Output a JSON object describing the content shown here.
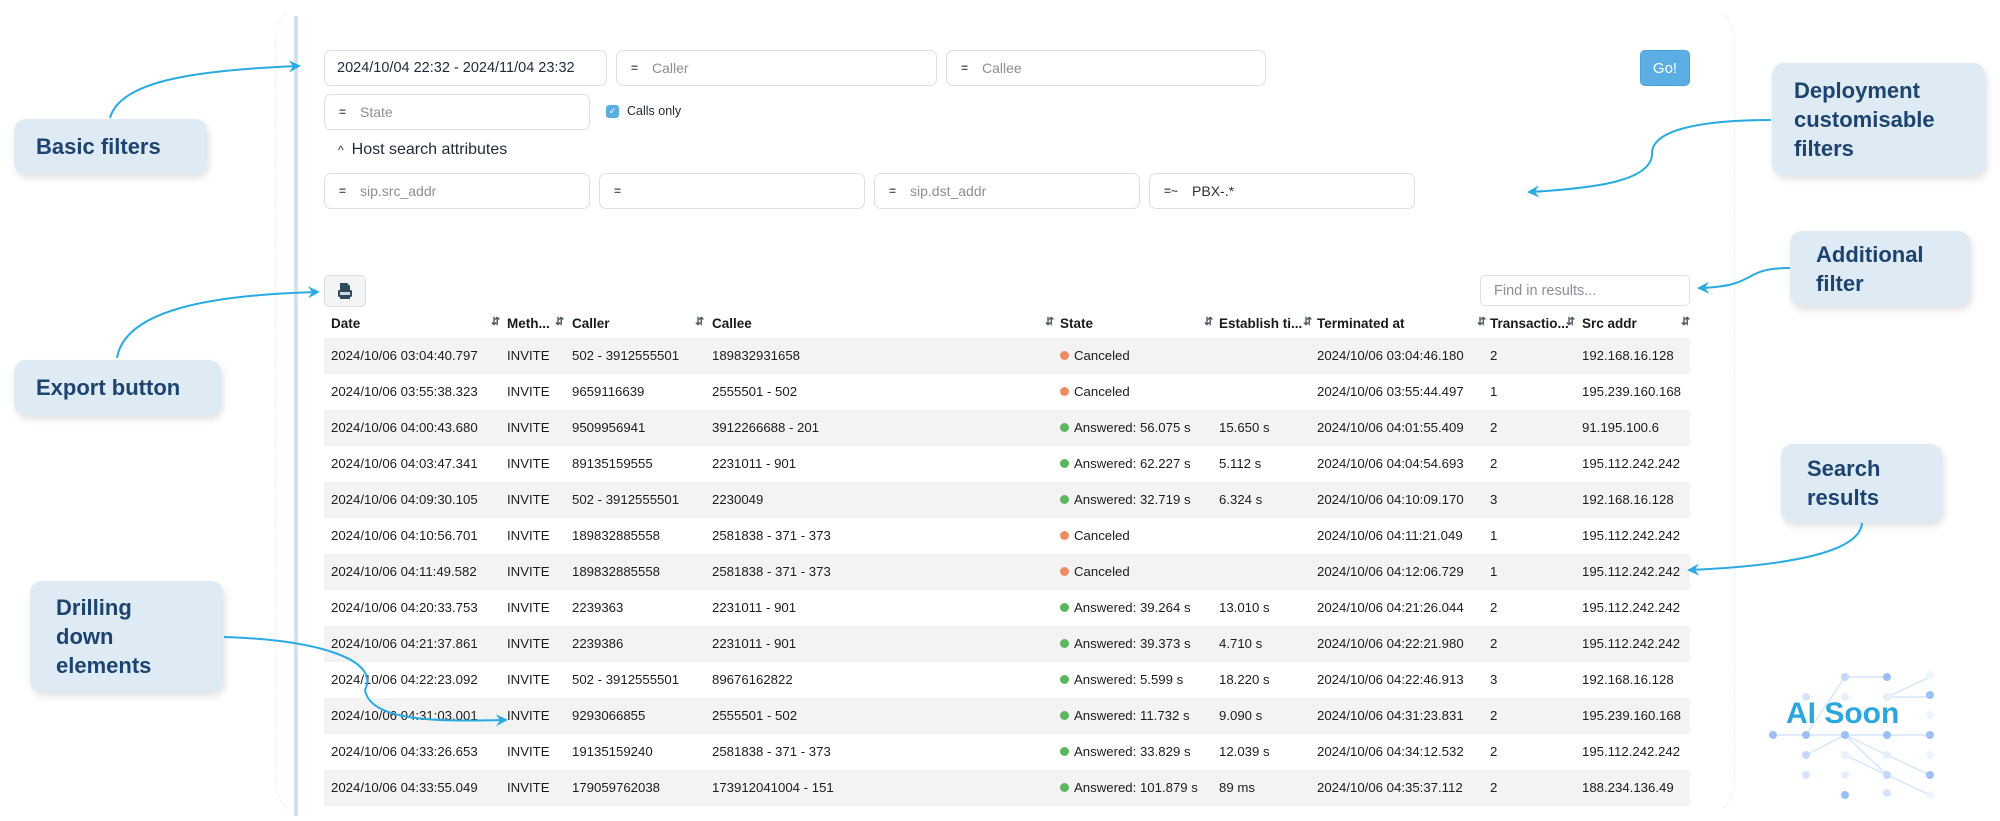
{
  "filters": {
    "date_range": "2024/10/04 22:32 - 2024/11/04 23:32",
    "caller": {
      "operator": "=",
      "placeholder": "Caller"
    },
    "callee": {
      "operator": "=",
      "placeholder": "Callee"
    },
    "state": {
      "operator": "=",
      "placeholder": "State"
    },
    "calls_only": {
      "label": "Calls only",
      "checked": true
    },
    "go_label": "Go!"
  },
  "host_search": {
    "toggle_label": "Host search attributes",
    "fields": [
      {
        "operator": "=",
        "placeholder": "sip.src_addr",
        "value": ""
      },
      {
        "operator": "=",
        "placeholder": "",
        "value": ""
      },
      {
        "operator": "=",
        "placeholder": "sip.dst_addr",
        "value": ""
      },
      {
        "operator": "=~",
        "placeholder": "",
        "value": "PBX-.*"
      }
    ]
  },
  "results": {
    "export_icon": "csv-export-icon",
    "find_placeholder": "Find in results...",
    "columns": [
      "Date",
      "Meth...",
      "Caller",
      "Callee",
      "State",
      "Establish ti...",
      "Terminated at",
      "Transactio...",
      "Src addr"
    ],
    "rows": [
      {
        "date": "2024/10/06 03:04:40.797",
        "method": "INVITE",
        "caller": "502 - 3912555501",
        "callee": "189832931658",
        "state": "Canceled",
        "state_type": "canceled",
        "establish": "",
        "terminated": "2024/10/06 03:04:46.180",
        "transactions": "2",
        "src": "192.168.16.128"
      },
      {
        "date": "2024/10/06 03:55:38.323",
        "method": "INVITE",
        "caller": "9659116639",
        "callee": "2555501 - 502",
        "state": "Canceled",
        "state_type": "canceled",
        "establish": "",
        "terminated": "2024/10/06 03:55:44.497",
        "transactions": "1",
        "src": "195.239.160.168"
      },
      {
        "date": "2024/10/06 04:00:43.680",
        "method": "INVITE",
        "caller": "9509956941",
        "callee": "3912266688 - 201",
        "state": "Answered: 56.075 s",
        "state_type": "answered",
        "establish": "15.650 s",
        "terminated": "2024/10/06 04:01:55.409",
        "transactions": "2",
        "src": "91.195.100.6"
      },
      {
        "date": "2024/10/06 04:03:47.341",
        "method": "INVITE",
        "caller": "89135159555",
        "callee": "2231011 - 901",
        "state": "Answered: 62.227 s",
        "state_type": "answered",
        "establish": "5.112 s",
        "terminated": "2024/10/06 04:04:54.693",
        "transactions": "2",
        "src": "195.112.242.242"
      },
      {
        "date": "2024/10/06 04:09:30.105",
        "method": "INVITE",
        "caller": "502 - 3912555501",
        "callee": "2230049",
        "state": "Answered: 32.719 s",
        "state_type": "answered",
        "establish": "6.324 s",
        "terminated": "2024/10/06 04:10:09.170",
        "transactions": "3",
        "src": "192.168.16.128"
      },
      {
        "date": "2024/10/06 04:10:56.701",
        "method": "INVITE",
        "caller": "189832885558",
        "callee": "2581838 - 371 - 373",
        "state": "Canceled",
        "state_type": "canceled",
        "establish": "",
        "terminated": "2024/10/06 04:11:21.049",
        "transactions": "1",
        "src": "195.112.242.242"
      },
      {
        "date": "2024/10/06 04:11:49.582",
        "method": "INVITE",
        "caller": "189832885558",
        "callee": "2581838 - 371 - 373",
        "state": "Canceled",
        "state_type": "canceled",
        "establish": "",
        "terminated": "2024/10/06 04:12:06.729",
        "transactions": "1",
        "src": "195.112.242.242"
      },
      {
        "date": "2024/10/06 04:20:33.753",
        "method": "INVITE",
        "caller": "2239363",
        "callee": "2231011 - 901",
        "state": "Answered: 39.264 s",
        "state_type": "answered",
        "establish": "13.010 s",
        "terminated": "2024/10/06 04:21:26.044",
        "transactions": "2",
        "src": "195.112.242.242"
      },
      {
        "date": "2024/10/06 04:21:37.861",
        "method": "INVITE",
        "caller": "2239386",
        "callee": "2231011 - 901",
        "state": "Answered: 39.373 s",
        "state_type": "answered",
        "establish": "4.710 s",
        "terminated": "2024/10/06 04:22:21.980",
        "transactions": "2",
        "src": "195.112.242.242"
      },
      {
        "date": "2024/10/06 04:22:23.092",
        "method": "INVITE",
        "caller": "502 - 3912555501",
        "callee": "89676162822",
        "state": "Answered: 5.599 s",
        "state_type": "answered",
        "establish": "18.220 s",
        "terminated": "2024/10/06 04:22:46.913",
        "transactions": "3",
        "src": "192.168.16.128"
      },
      {
        "date": "2024/10/06 04:31:03.001",
        "method": "INVITE",
        "caller": "9293066855",
        "callee": "2555501 - 502",
        "state": "Answered: 11.732 s",
        "state_type": "answered",
        "establish": "9.090 s",
        "terminated": "2024/10/06 04:31:23.831",
        "transactions": "2",
        "src": "195.239.160.168"
      },
      {
        "date": "2024/10/06 04:33:26.653",
        "method": "INVITE",
        "caller": "19135159240",
        "callee": "2581838 - 371 - 373",
        "state": "Answered: 33.829 s",
        "state_type": "answered",
        "establish": "12.039 s",
        "terminated": "2024/10/06 04:34:12.532",
        "transactions": "2",
        "src": "195.112.242.242"
      },
      {
        "date": "2024/10/06 04:33:55.049",
        "method": "INVITE",
        "caller": "179059762038",
        "callee": "173912041004 - 151",
        "state": "Answered: 101.879 s",
        "state_type": "answered",
        "establish": "89 ms",
        "terminated": "2024/10/06 04:35:37.112",
        "transactions": "2",
        "src": "188.234.136.49"
      }
    ]
  },
  "status_colors": {
    "canceled": "#f08a63",
    "answered": "#5cb85c"
  },
  "annotations": {
    "basic_filters": "Basic filters",
    "export_button": "Export button",
    "drilling_down": [
      "Drilling",
      "down",
      "elements"
    ],
    "deployment_filters": [
      "Deployment",
      "customisable",
      "filters"
    ],
    "additional_filter": [
      "Additional",
      "filter"
    ],
    "search_results": [
      "Search",
      "results"
    ],
    "ai_soon": "AI Soon"
  }
}
